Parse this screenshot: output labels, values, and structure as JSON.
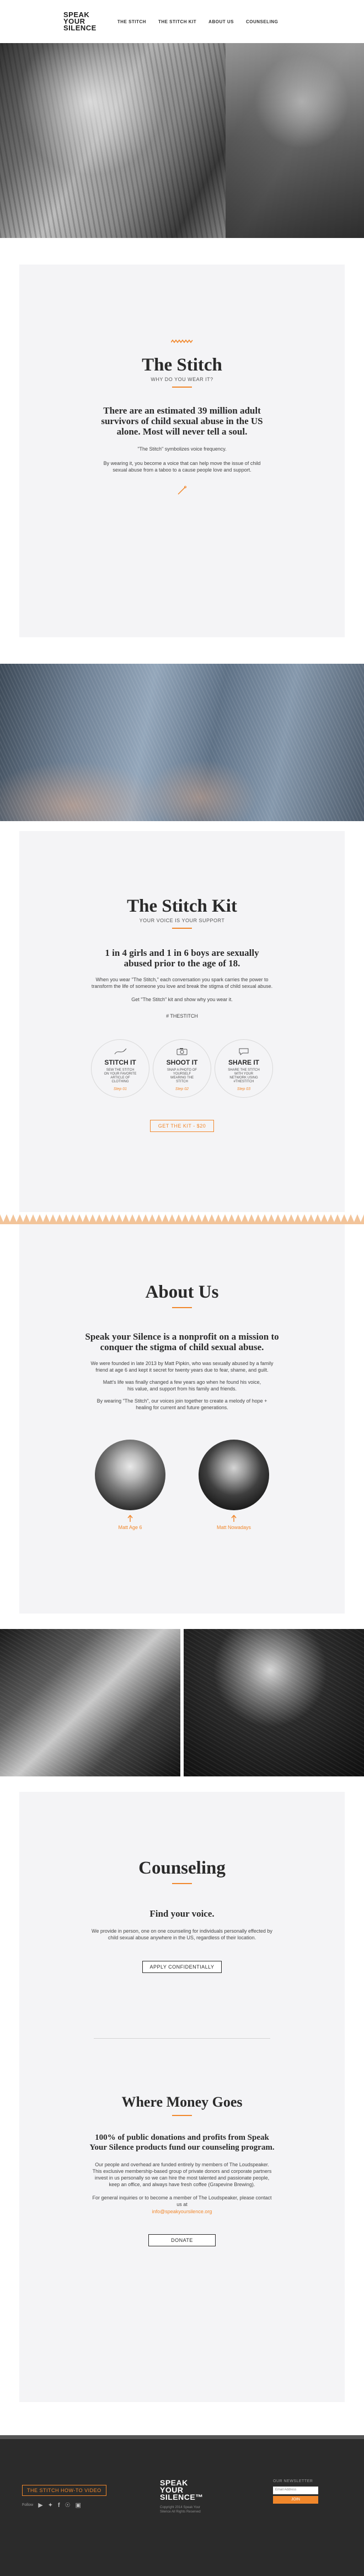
{
  "nav": {
    "logo_line1": "SPEAK",
    "logo_line2": "YOUR",
    "logo_line3": "SILENCE",
    "links": [
      "THE STITCH",
      "THE STITCH KIT",
      "ABOUT US",
      "COUNSELING"
    ]
  },
  "stitch": {
    "title": "The Stitch",
    "subtitle": "WHY DO YOU WEAR IT?",
    "lead": "There are an estimated 39 million adult survivors of child sexual abuse in the US alone. Most will never tell a soul.",
    "note": "\"The Stitch\" symbolizes voice frequency.",
    "body": "By wearing it, you become a voice that can help move the issue of child sexual abuse from a taboo to a cause people love and support."
  },
  "kit": {
    "title": "The Stitch Kit",
    "subtitle": "YOUR VOICE IS YOUR SUPPORT",
    "lead": "1 in 4 girls and 1 in 6 boys are sexually abused prior to the age of 18.",
    "body": "When you wear \"The Stitch,\" each conversation you spark carries the power to transform the life of someone you love and break the stigma of child sexual abuse.",
    "cta_text": "Get \"The Stitch\" kit and show why you wear it.",
    "hashtag": "# THESTITCH",
    "steps": [
      {
        "title": "STITCH IT",
        "desc": "SEW THE STITCH ON YOUR FAVORITE ARTICLE OF CLOTHING",
        "step": "Step 01"
      },
      {
        "title": "SHOOT IT",
        "desc": "SNAP A PHOTO OF YOURSELF WEARING THE STITCH",
        "step": "Step 02"
      },
      {
        "title": "SHARE IT",
        "desc": "SHARE THE STITCH WITH YOUR NETWORK USING #THESTITCH",
        "step": "Step 03"
      }
    ],
    "button": "GET THE KIT - $20"
  },
  "about": {
    "title": "About Us",
    "lead": "Speak your Silence is a nonprofit on a mission to conquer the stigma of child sexual abuse.",
    "p1": "We were founded in late 2013 by Matt Pipkin, who was sexually abused by a family friend at age 6 and kept it secret for twenty years due to fear, shame, and guilt.",
    "p2": "Matt's life was finally changed a few years ago when he found his voice, his value, and support from his family and friends.",
    "p3": "By wearing \"The Stitch\", our voices join together to create a melody of hope + healing for current and future generations.",
    "people": [
      {
        "name": "Matt Age 6"
      },
      {
        "name": "Matt Nowadays"
      }
    ]
  },
  "counseling": {
    "title": "Counseling",
    "lead": "Find your voice.",
    "body": "We provide in person, one on one counseling for individuals personally effected by child sexual abuse anywhere in the US, regardless of their location.",
    "button": "APPLY CONFIDENTIALLY"
  },
  "money": {
    "title": "Where Money Goes",
    "lead": "100% of public donations and profits from Speak Your Silence products fund our counseling program.",
    "body": "Our people and overhead are funded entirely by members of The Loudspeaker. This exclusive membership-based group of private donors and corporate partners invest in us personally so we can hire the most talented and passionate people, keep an office, and always have fresh coffee (Grapevine Brewing).",
    "inquiry": "For general inquiries or to become a member of The Loudspeaker, please contact us at",
    "email": "info@speakyoursilence.org",
    "button": "DONATE"
  },
  "footer": {
    "video_button": "THE STITCH HOW-TO VIDEO",
    "follow": "Follow",
    "logo_line1": "SPEAK",
    "logo_line2": "YOUR",
    "logo_line3": "SILENCE™",
    "copyright1": "Copyright 2014 Speak Your",
    "copyright2": "Silence All Rights Reserved",
    "newsletter": "Our Newsletter",
    "newsletter_placeholder": "Email Address",
    "join": "JOIN"
  },
  "colors": {
    "accent": "#f1872b",
    "section_bg": "#f4f4f6",
    "footer_bg": "#2b2b2b"
  }
}
